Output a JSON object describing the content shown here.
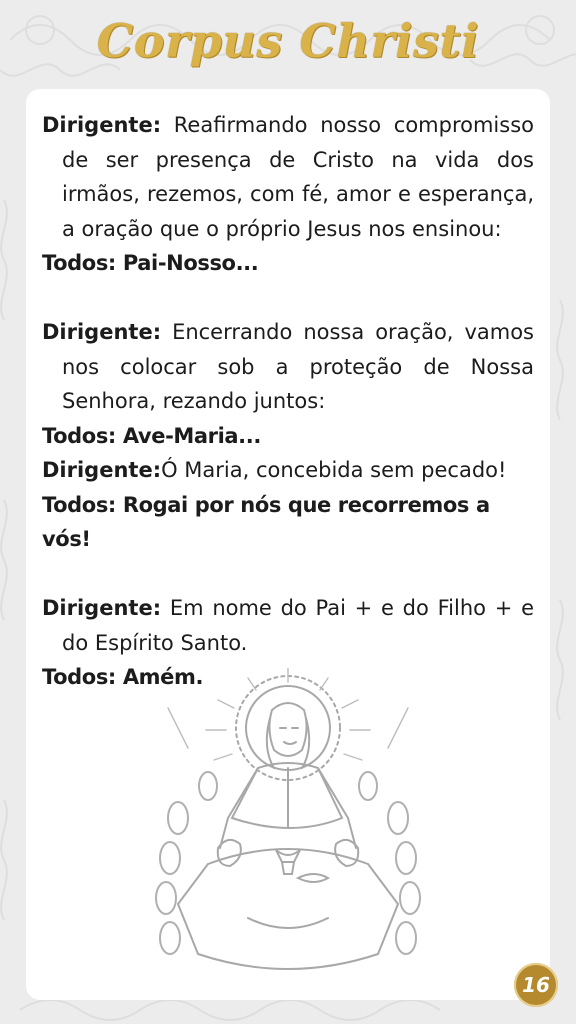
{
  "title": "Corpus Christi",
  "blocks": [
    {
      "speaker": "Dirigente:",
      "text": "Reafirmando nosso compromisso de ser presença de Cristo na vida dos irmãos, rezemos, com fé, amor e esperança, a oração que o próprio Jesus nos ensinou:"
    },
    {
      "response": "Todos: Pai-Nosso..."
    },
    {
      "speaker": "Dirigente:",
      "text": "Encerrando nossa oração, vamos nos colocar sob a proteção de Nossa Senhora, rezando juntos:"
    },
    {
      "response": "Todos: Ave-Maria..."
    },
    {
      "speaker": "Dirigente:",
      "text": "Ó Maria, concebida sem pecado!"
    },
    {
      "response": "Todos: Rogai por nós que recorremos a vós!"
    },
    {
      "speaker": "Dirigente:",
      "text": "Em nome do Pai + e do Filho + e do Espírito Santo."
    },
    {
      "response": "Todos: Amém."
    }
  ],
  "illustration": "jesus-eucharist-sketch",
  "page_number": "16",
  "colors": {
    "gold": "#d9b24a",
    "badge": "#b58a2e",
    "background": "#ececec",
    "card": "#ffffff"
  }
}
